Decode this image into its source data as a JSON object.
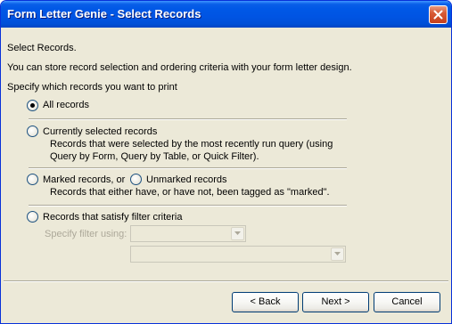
{
  "window": {
    "title": "Form Letter Genie - Select Records"
  },
  "content": {
    "heading": "Select Records.",
    "description": "You can store record selection and ordering criteria with your form letter design.",
    "prompt": "Specify which records you want to print"
  },
  "options": {
    "all_records": {
      "label": "All records",
      "selected": true
    },
    "currently_selected": {
      "label": "Currently selected records",
      "description_line1": "Records that were selected by the most recently run query (using",
      "description_line2": "Query by Form, Query by Table, or Quick Filter).",
      "selected": false
    },
    "marked": {
      "label": "Marked records, or",
      "unmarked_label": "Unmarked records",
      "description": "Records that either have, or have not, been tagged as \"marked\".",
      "selected": false
    },
    "filter": {
      "label": "Records that satisfy filter criteria",
      "specify_label": "Specify filter using:",
      "filter_type_value": "",
      "filter_value": "",
      "selected": false
    }
  },
  "buttons": {
    "back": "< Back",
    "next": "Next >",
    "cancel": "Cancel"
  },
  "icons": {
    "close": "close-icon",
    "dropdown": "chevron-down-icon"
  },
  "colors": {
    "titlebar": "#0054E3",
    "dialog_bg": "#ECE9D8",
    "close_button": "#D85A36",
    "disabled_text": "#ACA899"
  }
}
